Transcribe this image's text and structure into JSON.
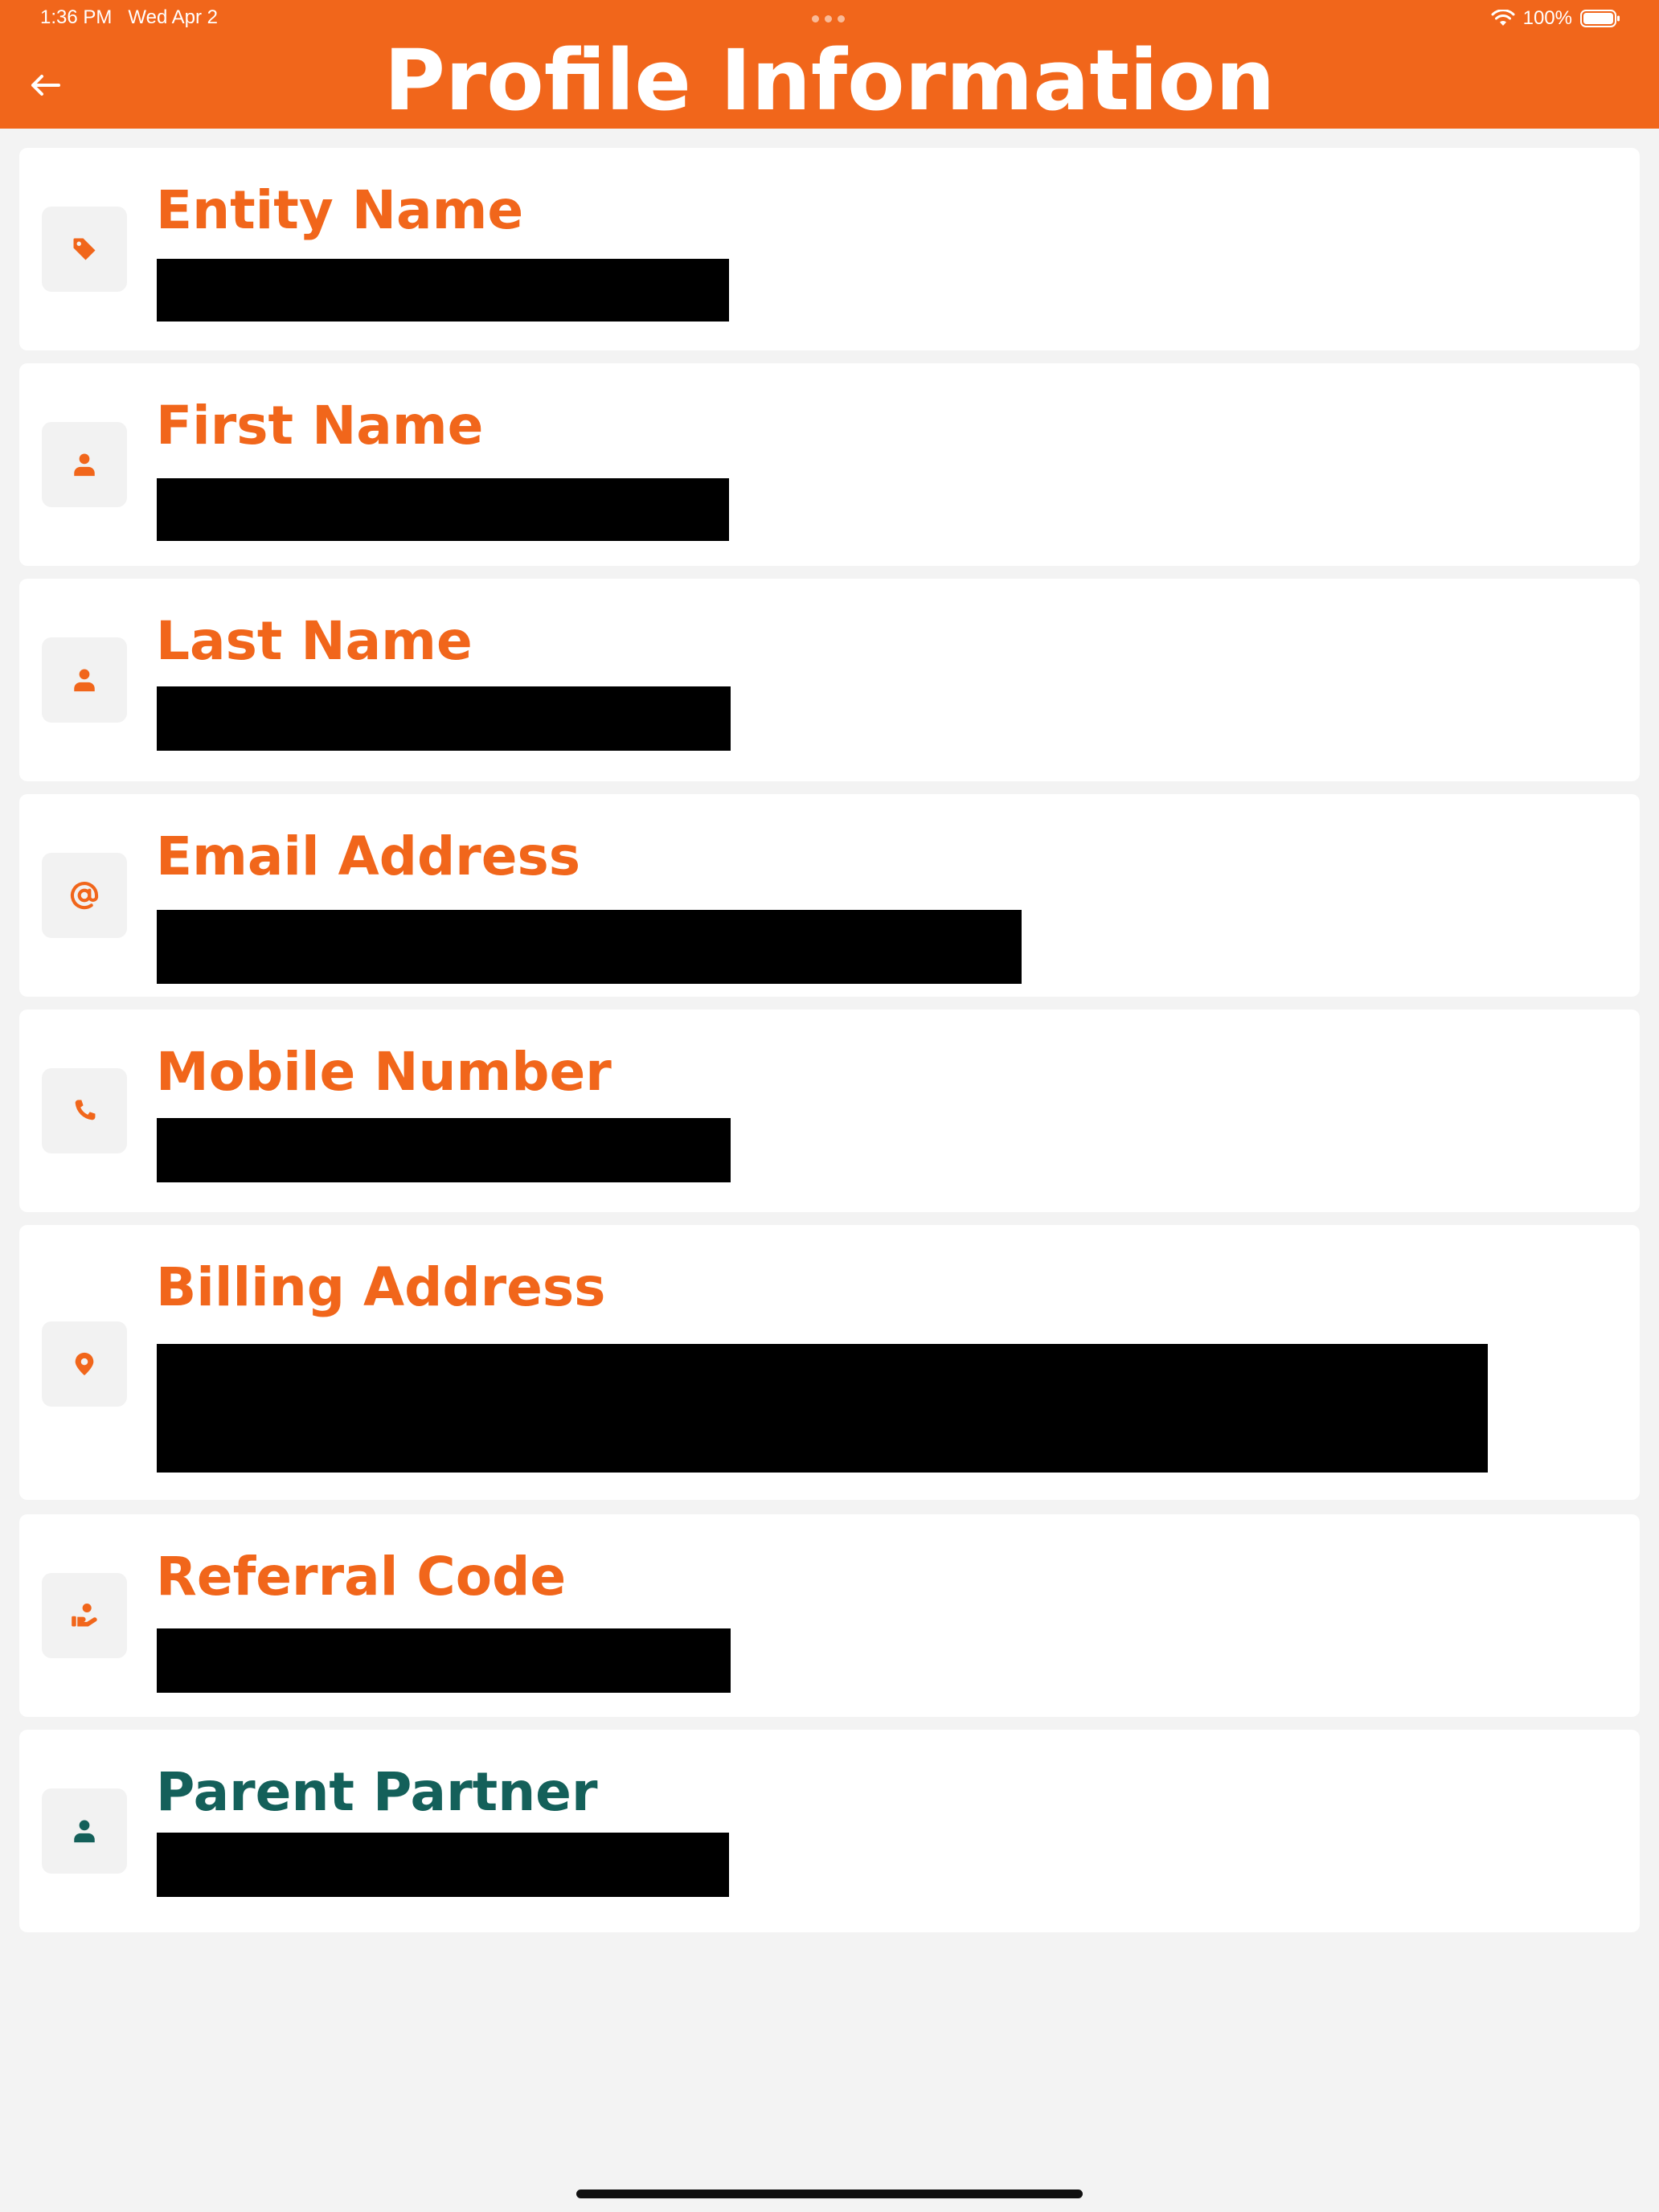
{
  "status_bar": {
    "time": "1:36 PM",
    "date": "Wed Apr 2",
    "battery": "100%",
    "icons": [
      "wifi-icon",
      "battery-icon"
    ]
  },
  "header": {
    "title": "Profile Information",
    "back_icon": "arrow-left-icon"
  },
  "colors": {
    "accent": "#f1661b",
    "teal": "#14605a",
    "background": "#f3f3f3"
  },
  "fields": [
    {
      "label": "Entity Name",
      "icon": "tag-icon",
      "value": "[redacted]"
    },
    {
      "label": "First Name",
      "icon": "user-icon",
      "value": "[redacted]"
    },
    {
      "label": "Last Name",
      "icon": "user-icon",
      "value": "[redacted]"
    },
    {
      "label": "Email Address",
      "icon": "at-sign-icon",
      "value": "[redacted]"
    },
    {
      "label": "Mobile Number",
      "icon": "phone-icon",
      "value": "[redacted]"
    },
    {
      "label": "Billing Address",
      "icon": "location-pin-icon",
      "value": "[redacted]"
    },
    {
      "label": "Referral Code",
      "icon": "hand-user-icon",
      "value": "[redacted]"
    },
    {
      "label": "Parent Partner",
      "icon": "user-icon",
      "value": "[redacted]"
    }
  ]
}
